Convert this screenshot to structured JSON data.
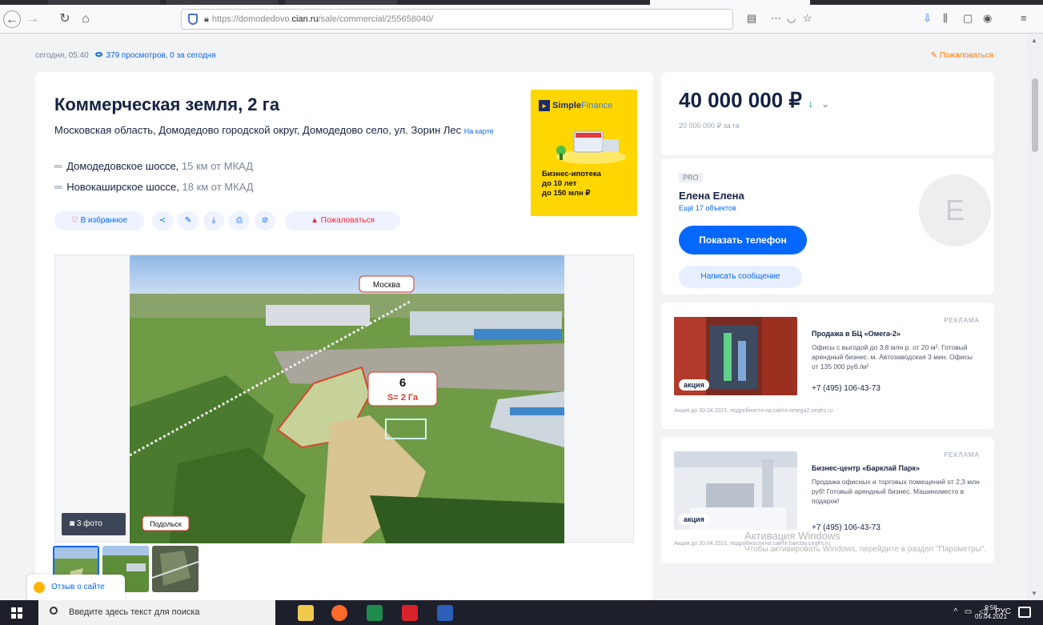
{
  "browser": {
    "url_prefix": "https://domodedovo.",
    "url_domain": "cian.ru",
    "url_path": "/sale/commercial/255658040/",
    "back_icon": "back-arrow-icon",
    "forward_icon": "forward-arrow-icon",
    "reload_icon": "reload-icon",
    "home_icon": "home-icon"
  },
  "meta": {
    "date": "сегодня, 05:40",
    "views": "379 просмотров, 0 за сегодня",
    "complain": "Пожаловаться"
  },
  "listing": {
    "title": "Коммерческая земля, 2 га",
    "address": "Московская область, Домодедово городской округ, Домодедово село, ул. Зорин Лес",
    "map_link": "На карте",
    "roads": [
      {
        "name": "Домодедовское шоссе,",
        "dist": "15 км от МКАД"
      },
      {
        "name": "Новокаширское шоссе,",
        "dist": "18 км от МКАД"
      }
    ],
    "actions": {
      "favorite": "В избранное",
      "report": "Пожаловаться"
    },
    "photo_count": "3 фото",
    "photo_labels": {
      "moscow": "Москва",
      "podolsk": "Подольск",
      "plot_num": "6",
      "plot_area": "S= 2 Га"
    }
  },
  "banner": {
    "brand_a": "Simple",
    "brand_b": "Finance",
    "line1": "Бизнес-ипотека",
    "line2": "до 10 лет",
    "line3": "до 150 млн ₽"
  },
  "price": {
    "value": "40 000 000 ₽",
    "per_area": "20 000 000 ₽ за га"
  },
  "agent": {
    "badge": "PRO",
    "name": "Елена Елена",
    "objects": "Ещё 17 объектов",
    "initial": "Е",
    "show_phone": "Показать телефон",
    "write": "Написать сообщение"
  },
  "ads": [
    {
      "label": "РЕКЛАМА",
      "badge": "акция",
      "title": "Продажа в БЦ «Омега-2»",
      "desc": "Офисы с выгодой до 3,8 млн р. от 20 м². Готовый арендный бизнес. м. Автозаводская 3 мин. Офисы от 135 000 руб./м²",
      "phone": "+7 (495) 106-43-73",
      "foot": "Акция до 30.04.2021, подробности на сайте omega2.ceqfrs.ru"
    },
    {
      "label": "РЕКЛАМА",
      "badge": "акция",
      "title": "Бизнес-центр «Барклай Парк»",
      "desc": "Продажа офисных и торговых помещений от 2,3 млн руб! Готовый арендный бизнес. Машиноместо в подарок!",
      "phone": "+7 (495) 106-43-73",
      "foot": "Акция до 30.04.2021, подробности на сайте barclay.ceqfrs.ru"
    }
  ],
  "feedback": "Отзыв о сайте",
  "watermark": {
    "title": "Активация Windows",
    "text": "Чтобы активировать Windows, перейдите в раздел \"Параметры\"."
  },
  "taskbar": {
    "search_placeholder": "Введите здесь текст для поиска",
    "lang": "РУС",
    "time": "9:56",
    "date": "05.04.2021"
  }
}
